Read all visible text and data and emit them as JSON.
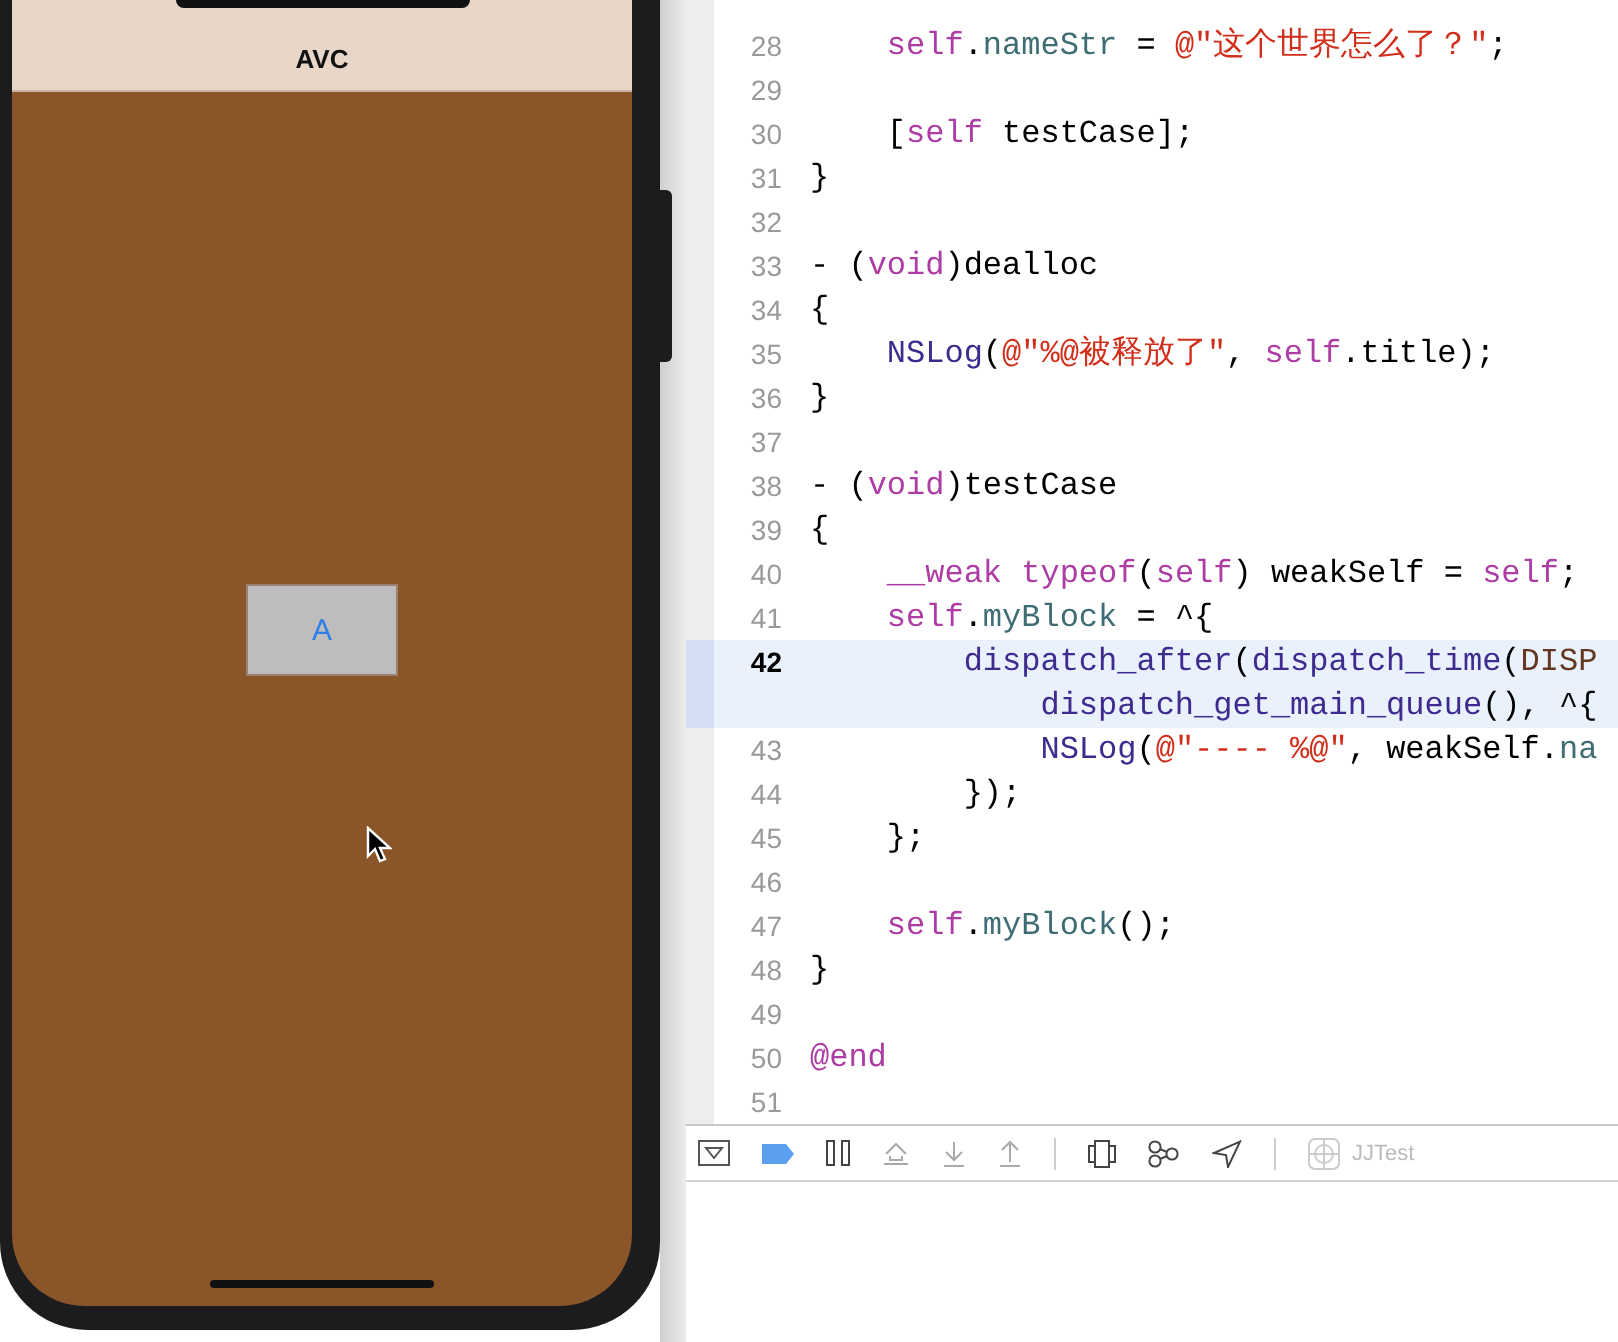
{
  "simulator": {
    "nav_title": "AVC",
    "button_label": "A"
  },
  "editor": {
    "lines": [
      {
        "number": "28",
        "current": false,
        "tokens": [
          {
            "kind": "keyword",
            "text": "    self"
          },
          {
            "kind": "plain",
            "text": "."
          },
          {
            "kind": "project",
            "text": "nameStr"
          },
          {
            "kind": "plain",
            "text": " = "
          },
          {
            "kind": "string",
            "text": "@\"这个世界怎么了？\""
          },
          {
            "kind": "plain",
            "text": ";"
          }
        ]
      },
      {
        "number": "29",
        "current": false
      },
      {
        "number": "30",
        "current": false,
        "tokens": [
          {
            "kind": "plain",
            "text": "    ["
          },
          {
            "kind": "keyword",
            "text": "self"
          },
          {
            "kind": "plain",
            "text": " testCase];"
          }
        ]
      },
      {
        "number": "31",
        "current": false,
        "tokens": [
          {
            "kind": "plain",
            "text": "}"
          }
        ]
      },
      {
        "number": "32",
        "current": false
      },
      {
        "number": "33",
        "current": false,
        "tokens": [
          {
            "kind": "plain",
            "text": "- ("
          },
          {
            "kind": "keyword",
            "text": "void"
          },
          {
            "kind": "plain",
            "text": ")dealloc"
          }
        ]
      },
      {
        "number": "34",
        "current": false,
        "tokens": [
          {
            "kind": "plain",
            "text": "{"
          }
        ]
      },
      {
        "number": "35",
        "current": false,
        "tokens": [
          {
            "kind": "system",
            "text": "    NSLog"
          },
          {
            "kind": "plain",
            "text": "("
          },
          {
            "kind": "string",
            "text": "@\"%@被释放了\""
          },
          {
            "kind": "plain",
            "text": ", "
          },
          {
            "kind": "keyword",
            "text": "self"
          },
          {
            "kind": "plain",
            "text": ".title);"
          }
        ]
      },
      {
        "number": "36",
        "current": false,
        "tokens": [
          {
            "kind": "plain",
            "text": "}"
          }
        ]
      },
      {
        "number": "37",
        "current": false
      },
      {
        "number": "38",
        "current": false,
        "tokens": [
          {
            "kind": "plain",
            "text": "- ("
          },
          {
            "kind": "keyword",
            "text": "void"
          },
          {
            "kind": "plain",
            "text": ")testCase"
          }
        ]
      },
      {
        "number": "39",
        "current": false,
        "tokens": [
          {
            "kind": "plain",
            "text": "{"
          }
        ]
      },
      {
        "number": "40",
        "current": false,
        "tokens": [
          {
            "kind": "keyword",
            "text": "    __weak typeof"
          },
          {
            "kind": "plain",
            "text": "("
          },
          {
            "kind": "keyword",
            "text": "self"
          },
          {
            "kind": "plain",
            "text": ") weakSelf = "
          },
          {
            "kind": "keyword",
            "text": "self"
          },
          {
            "kind": "plain",
            "text": ";"
          }
        ]
      },
      {
        "number": "41",
        "current": false,
        "tokens": [
          {
            "kind": "keyword",
            "text": "    self"
          },
          {
            "kind": "plain",
            "text": "."
          },
          {
            "kind": "project",
            "text": "myBlock"
          },
          {
            "kind": "plain",
            "text": " = ^{"
          }
        ]
      },
      {
        "number": "42",
        "current": true,
        "tokens": [
          {
            "kind": "system",
            "text": "        dispatch_after"
          },
          {
            "kind": "plain",
            "text": "("
          },
          {
            "kind": "system",
            "text": "dispatch_time"
          },
          {
            "kind": "plain",
            "text": "("
          },
          {
            "kind": "macro",
            "text": "DISP"
          }
        ],
        "wrapped_tokens": [
          {
            "kind": "system",
            "text": "            dispatch_get_main_queue"
          },
          {
            "kind": "plain",
            "text": "(), ^{"
          }
        ]
      },
      {
        "number": "43",
        "current": false,
        "tokens": [
          {
            "kind": "system",
            "text": "            NSLog"
          },
          {
            "kind": "plain",
            "text": "("
          },
          {
            "kind": "string",
            "text": "@\"---- %@\""
          },
          {
            "kind": "plain",
            "text": ", weakSelf."
          },
          {
            "kind": "project",
            "text": "na"
          }
        ]
      },
      {
        "number": "44",
        "current": false,
        "tokens": [
          {
            "kind": "plain",
            "text": "        });"
          }
        ]
      },
      {
        "number": "45",
        "current": false,
        "tokens": [
          {
            "kind": "plain",
            "text": "    };"
          }
        ]
      },
      {
        "number": "46",
        "current": false
      },
      {
        "number": "47",
        "current": false,
        "tokens": [
          {
            "kind": "keyword",
            "text": "    self"
          },
          {
            "kind": "plain",
            "text": "."
          },
          {
            "kind": "project",
            "text": "myBlock"
          },
          {
            "kind": "plain",
            "text": "();"
          }
        ]
      },
      {
        "number": "48",
        "current": false,
        "tokens": [
          {
            "kind": "plain",
            "text": "}"
          }
        ]
      },
      {
        "number": "49",
        "current": false
      },
      {
        "number": "50",
        "current": false,
        "tokens": [
          {
            "kind": "keyword",
            "text": "@end"
          }
        ]
      },
      {
        "number": "51",
        "current": false
      }
    ]
  },
  "debug_bar": {
    "breakpoints_active": true,
    "target": "JJTest"
  }
}
